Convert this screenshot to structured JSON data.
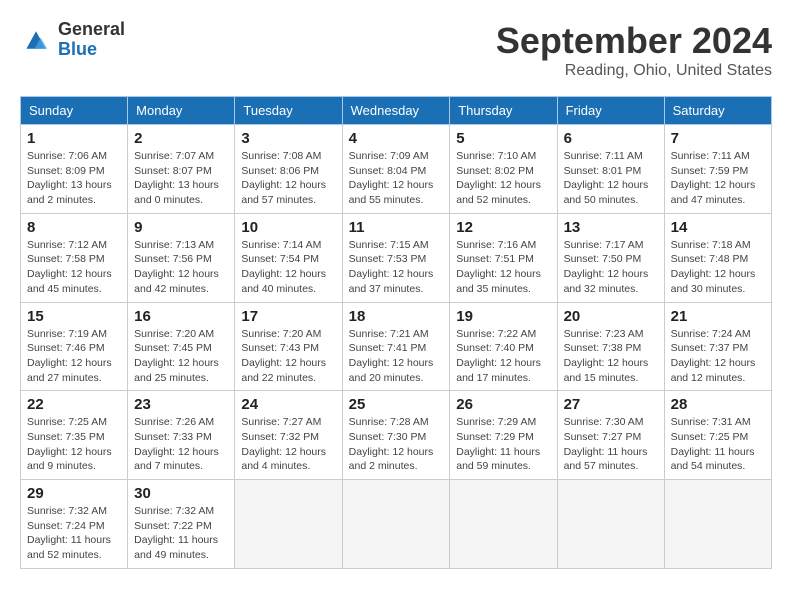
{
  "header": {
    "logo_general": "General",
    "logo_blue": "Blue",
    "title": "September 2024",
    "location": "Reading, Ohio, United States"
  },
  "calendar": {
    "days_of_week": [
      "Sunday",
      "Monday",
      "Tuesday",
      "Wednesday",
      "Thursday",
      "Friday",
      "Saturday"
    ],
    "weeks": [
      [
        {
          "day": "1",
          "info": "Sunrise: 7:06 AM\nSunset: 8:09 PM\nDaylight: 13 hours\nand 2 minutes."
        },
        {
          "day": "2",
          "info": "Sunrise: 7:07 AM\nSunset: 8:07 PM\nDaylight: 13 hours\nand 0 minutes."
        },
        {
          "day": "3",
          "info": "Sunrise: 7:08 AM\nSunset: 8:06 PM\nDaylight: 12 hours\nand 57 minutes."
        },
        {
          "day": "4",
          "info": "Sunrise: 7:09 AM\nSunset: 8:04 PM\nDaylight: 12 hours\nand 55 minutes."
        },
        {
          "day": "5",
          "info": "Sunrise: 7:10 AM\nSunset: 8:02 PM\nDaylight: 12 hours\nand 52 minutes."
        },
        {
          "day": "6",
          "info": "Sunrise: 7:11 AM\nSunset: 8:01 PM\nDaylight: 12 hours\nand 50 minutes."
        },
        {
          "day": "7",
          "info": "Sunrise: 7:11 AM\nSunset: 7:59 PM\nDaylight: 12 hours\nand 47 minutes."
        }
      ],
      [
        {
          "day": "8",
          "info": "Sunrise: 7:12 AM\nSunset: 7:58 PM\nDaylight: 12 hours\nand 45 minutes."
        },
        {
          "day": "9",
          "info": "Sunrise: 7:13 AM\nSunset: 7:56 PM\nDaylight: 12 hours\nand 42 minutes."
        },
        {
          "day": "10",
          "info": "Sunrise: 7:14 AM\nSunset: 7:54 PM\nDaylight: 12 hours\nand 40 minutes."
        },
        {
          "day": "11",
          "info": "Sunrise: 7:15 AM\nSunset: 7:53 PM\nDaylight: 12 hours\nand 37 minutes."
        },
        {
          "day": "12",
          "info": "Sunrise: 7:16 AM\nSunset: 7:51 PM\nDaylight: 12 hours\nand 35 minutes."
        },
        {
          "day": "13",
          "info": "Sunrise: 7:17 AM\nSunset: 7:50 PM\nDaylight: 12 hours\nand 32 minutes."
        },
        {
          "day": "14",
          "info": "Sunrise: 7:18 AM\nSunset: 7:48 PM\nDaylight: 12 hours\nand 30 minutes."
        }
      ],
      [
        {
          "day": "15",
          "info": "Sunrise: 7:19 AM\nSunset: 7:46 PM\nDaylight: 12 hours\nand 27 minutes."
        },
        {
          "day": "16",
          "info": "Sunrise: 7:20 AM\nSunset: 7:45 PM\nDaylight: 12 hours\nand 25 minutes."
        },
        {
          "day": "17",
          "info": "Sunrise: 7:20 AM\nSunset: 7:43 PM\nDaylight: 12 hours\nand 22 minutes."
        },
        {
          "day": "18",
          "info": "Sunrise: 7:21 AM\nSunset: 7:41 PM\nDaylight: 12 hours\nand 20 minutes."
        },
        {
          "day": "19",
          "info": "Sunrise: 7:22 AM\nSunset: 7:40 PM\nDaylight: 12 hours\nand 17 minutes."
        },
        {
          "day": "20",
          "info": "Sunrise: 7:23 AM\nSunset: 7:38 PM\nDaylight: 12 hours\nand 15 minutes."
        },
        {
          "day": "21",
          "info": "Sunrise: 7:24 AM\nSunset: 7:37 PM\nDaylight: 12 hours\nand 12 minutes."
        }
      ],
      [
        {
          "day": "22",
          "info": "Sunrise: 7:25 AM\nSunset: 7:35 PM\nDaylight: 12 hours\nand 9 minutes."
        },
        {
          "day": "23",
          "info": "Sunrise: 7:26 AM\nSunset: 7:33 PM\nDaylight: 12 hours\nand 7 minutes."
        },
        {
          "day": "24",
          "info": "Sunrise: 7:27 AM\nSunset: 7:32 PM\nDaylight: 12 hours\nand 4 minutes."
        },
        {
          "day": "25",
          "info": "Sunrise: 7:28 AM\nSunset: 7:30 PM\nDaylight: 12 hours\nand 2 minutes."
        },
        {
          "day": "26",
          "info": "Sunrise: 7:29 AM\nSunset: 7:29 PM\nDaylight: 11 hours\nand 59 minutes."
        },
        {
          "day": "27",
          "info": "Sunrise: 7:30 AM\nSunset: 7:27 PM\nDaylight: 11 hours\nand 57 minutes."
        },
        {
          "day": "28",
          "info": "Sunrise: 7:31 AM\nSunset: 7:25 PM\nDaylight: 11 hours\nand 54 minutes."
        }
      ],
      [
        {
          "day": "29",
          "info": "Sunrise: 7:32 AM\nSunset: 7:24 PM\nDaylight: 11 hours\nand 52 minutes."
        },
        {
          "day": "30",
          "info": "Sunrise: 7:32 AM\nSunset: 7:22 PM\nDaylight: 11 hours\nand 49 minutes."
        },
        {
          "day": "",
          "info": ""
        },
        {
          "day": "",
          "info": ""
        },
        {
          "day": "",
          "info": ""
        },
        {
          "day": "",
          "info": ""
        },
        {
          "day": "",
          "info": ""
        }
      ]
    ]
  }
}
